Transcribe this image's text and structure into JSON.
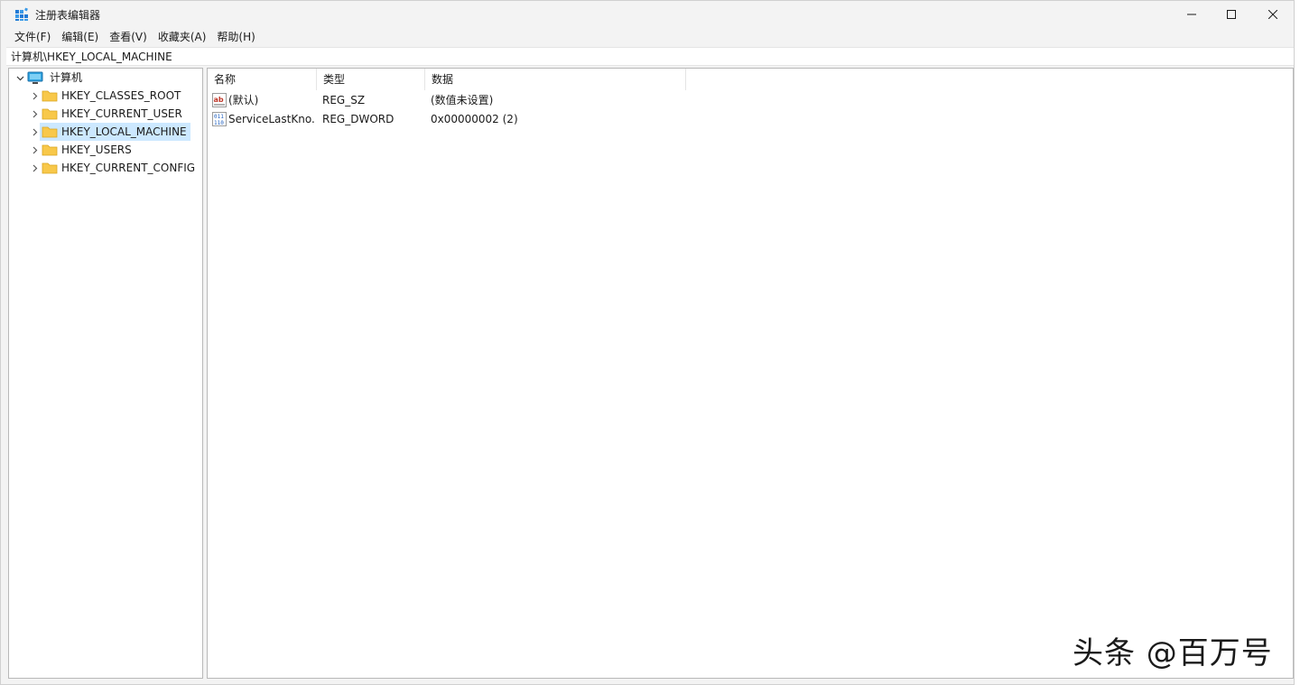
{
  "window": {
    "title": "注册表编辑器"
  },
  "menu": [
    {
      "label": "文件(F)"
    },
    {
      "label": "编辑(E)"
    },
    {
      "label": "查看(V)"
    },
    {
      "label": "收藏夹(A)"
    },
    {
      "label": "帮助(H)"
    }
  ],
  "address": "计算机\\HKEY_LOCAL_MACHINE",
  "tree": {
    "root": "计算机",
    "items": [
      {
        "label": "HKEY_CLASSES_ROOT",
        "selected": false
      },
      {
        "label": "HKEY_CURRENT_USER",
        "selected": false
      },
      {
        "label": "HKEY_LOCAL_MACHINE",
        "selected": true
      },
      {
        "label": "HKEY_USERS",
        "selected": false
      },
      {
        "label": "HKEY_CURRENT_CONFIG",
        "selected": false
      }
    ]
  },
  "list": {
    "columns": [
      "名称",
      "类型",
      "数据"
    ],
    "rows": [
      {
        "icon": "string-value-icon",
        "name": "(默认)",
        "type": "REG_SZ",
        "data": "(数值未设置)"
      },
      {
        "icon": "binary-value-icon",
        "name": "ServiceLastKno...",
        "type": "REG_DWORD",
        "data": "0x00000002 (2)"
      }
    ]
  },
  "watermark": "头条 @百万号",
  "colors": {
    "selection": "#cce8ff",
    "folder": "#f8c84a",
    "accent": "#0067c0"
  }
}
